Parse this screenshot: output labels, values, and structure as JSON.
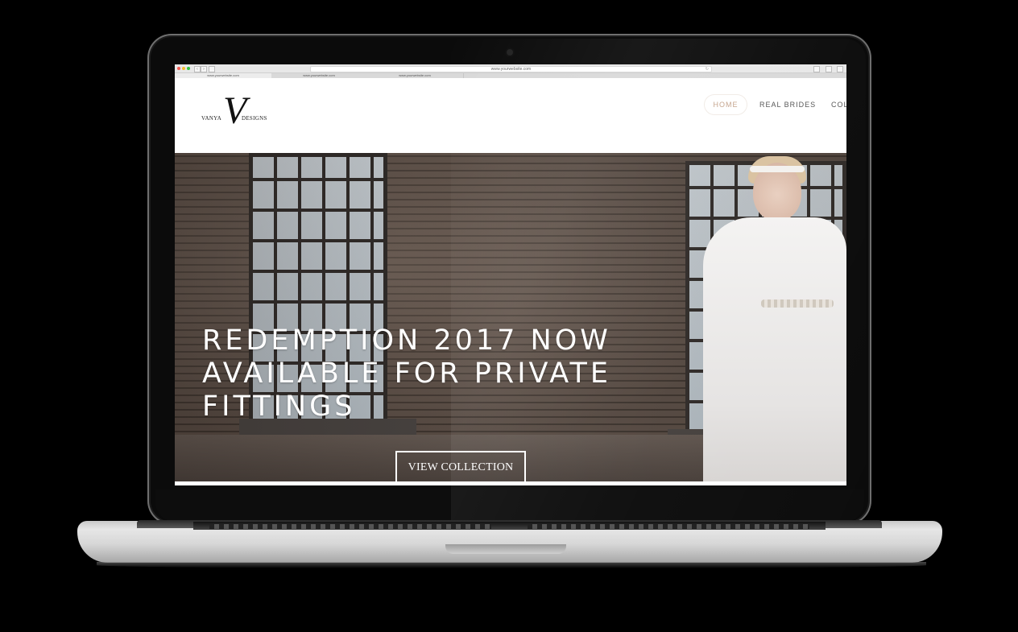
{
  "browser": {
    "url": "www.yourwebsite.com",
    "back_label": "‹",
    "forward_label": "›",
    "tabs": [
      {
        "label": "www.yourwebsite.com",
        "active": true
      },
      {
        "label": "www.yourwebsite.com",
        "active": false
      },
      {
        "label": "www.yourwebsite.com",
        "active": false
      }
    ]
  },
  "logo": {
    "left_text": "VANYA",
    "letter": "V",
    "right_text": "DESIGNS"
  },
  "nav": {
    "items": [
      {
        "label": "HOME",
        "active": true
      },
      {
        "label": "REAL BRIDES",
        "active": false
      },
      {
        "label": "COL",
        "active": false
      }
    ]
  },
  "hero": {
    "headline": "REDEMPTION 2017 NOW AVAILABLE FOR PRIVATE FITTINGS",
    "cta_label": "VIEW COLLECTION"
  },
  "colors": {
    "nav_active": "#c4a28a",
    "hero_text": "#ffffff",
    "page_background": "#000000"
  }
}
